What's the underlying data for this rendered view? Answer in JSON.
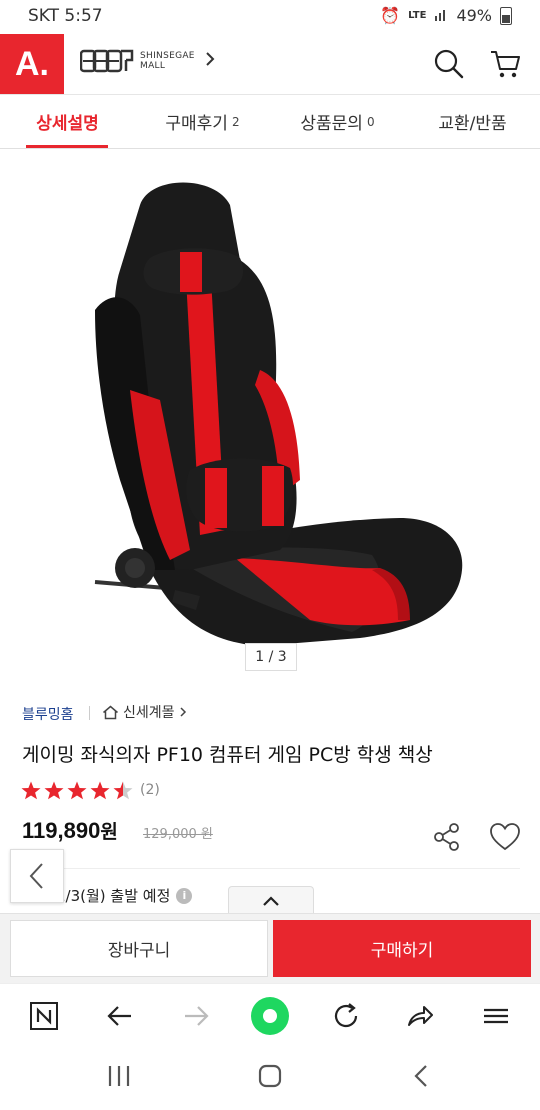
{
  "status_bar": {
    "carrier_time": "SKT 5:57",
    "network": "LTE",
    "battery": "49%"
  },
  "header": {
    "logo_text": "A.",
    "mall_brand_line1": "SHINSEGAE",
    "mall_brand_line2": "MALL",
    "search_icon": "search-icon",
    "cart_icon": "cart-icon"
  },
  "tabs": [
    {
      "label": "상세설명",
      "count": ""
    },
    {
      "label": "구매후기",
      "count": "2"
    },
    {
      "label": "상품문의",
      "count": "0"
    },
    {
      "label": "교환/반품",
      "count": ""
    }
  ],
  "product": {
    "image_pager": "1 / 3",
    "brand": "블루밍홈",
    "mall": "신세계몰",
    "title": "게이밍 좌식의자 PF10 컴퓨터 게임 PC방 학생 책상",
    "rating": 4.5,
    "review_count": "(2)",
    "price": "119,890",
    "price_unit": "원",
    "original_price": "129,000 원",
    "shipping": "1/3(월) 출발 예정",
    "share_icon": "share-icon",
    "wishlist_icon": "heart-icon"
  },
  "actions": {
    "cart_label": "장바구니",
    "buy_label": "구매하기"
  },
  "colors": {
    "accent": "#e8262e",
    "brand_link": "#1b3f8f",
    "nav_green": "#1ed760"
  }
}
